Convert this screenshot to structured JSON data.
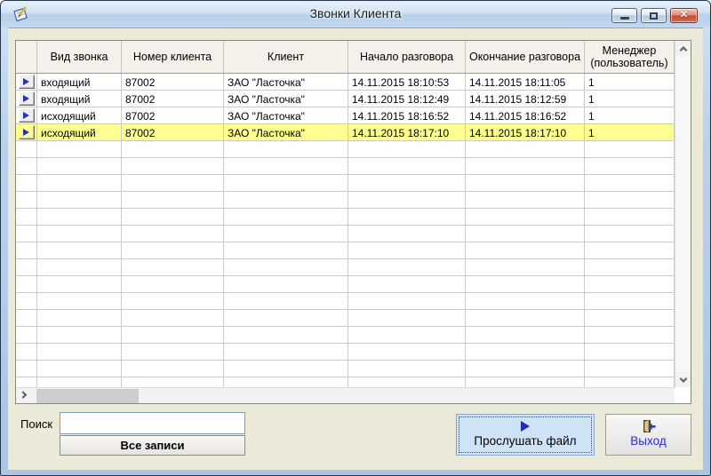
{
  "window": {
    "title": "Звонки Клиента"
  },
  "icons": {
    "app_icon": "notepad-pen",
    "minimize": "minimize-bar",
    "maximize": "maximize-square",
    "close": "✕",
    "play": "play-triangle",
    "exit": "open-door-arrow",
    "row_indicator": "blue-right-arrow",
    "scroll_up": "chevron-up",
    "scroll_down": "chevron-down",
    "scroll_left": "chevron-left",
    "scroll_right": "chevron-right"
  },
  "grid": {
    "columns": [
      "Вид звонка",
      "Номер клиента",
      "Клиент",
      "Начало разговора",
      "Окончание разговора",
      "Менеджер (пользователь)"
    ],
    "rows": [
      {
        "type": "входящий",
        "client_number": "87002",
        "client": "ЗАО \"Ласточка\"",
        "start": "14.11.2015 18:10:53",
        "end": "14.11.2015 18:11:05",
        "manager": "1"
      },
      {
        "type": "входящий",
        "client_number": "87002",
        "client": "ЗАО \"Ласточка\"",
        "start": "14.11.2015 18:12:49",
        "end": "14.11.2015 18:12:59",
        "manager": "1"
      },
      {
        "type": "исходящий",
        "client_number": "87002",
        "client": "ЗАО \"Ласточка\"",
        "start": "14.11.2015 18:16:52",
        "end": "14.11.2015 18:16:52",
        "manager": "1"
      },
      {
        "type": "исходящий",
        "client_number": "87002",
        "client": "ЗАО \"Ласточка\"",
        "start": "14.11.2015 18:17:10",
        "end": "14.11.2015 18:17:10",
        "manager": "1"
      }
    ],
    "selected_row": 3
  },
  "search": {
    "label": "Поиск",
    "value": "",
    "all_records_button": "Все записи"
  },
  "buttons": {
    "play": "Прослушать файл",
    "exit": "Выход"
  },
  "colors": {
    "row_highlight": "#ffff8f",
    "client_background": "#ece9d8",
    "titlebar_top": "#e6f0fc",
    "titlebar_bottom": "#a9c7e3",
    "play_button_background": "#cfe3f6",
    "exit_label_color": "#2b2bd5",
    "row_indicator_arrow": "#2333c1",
    "close_button": "#c4502f"
  }
}
